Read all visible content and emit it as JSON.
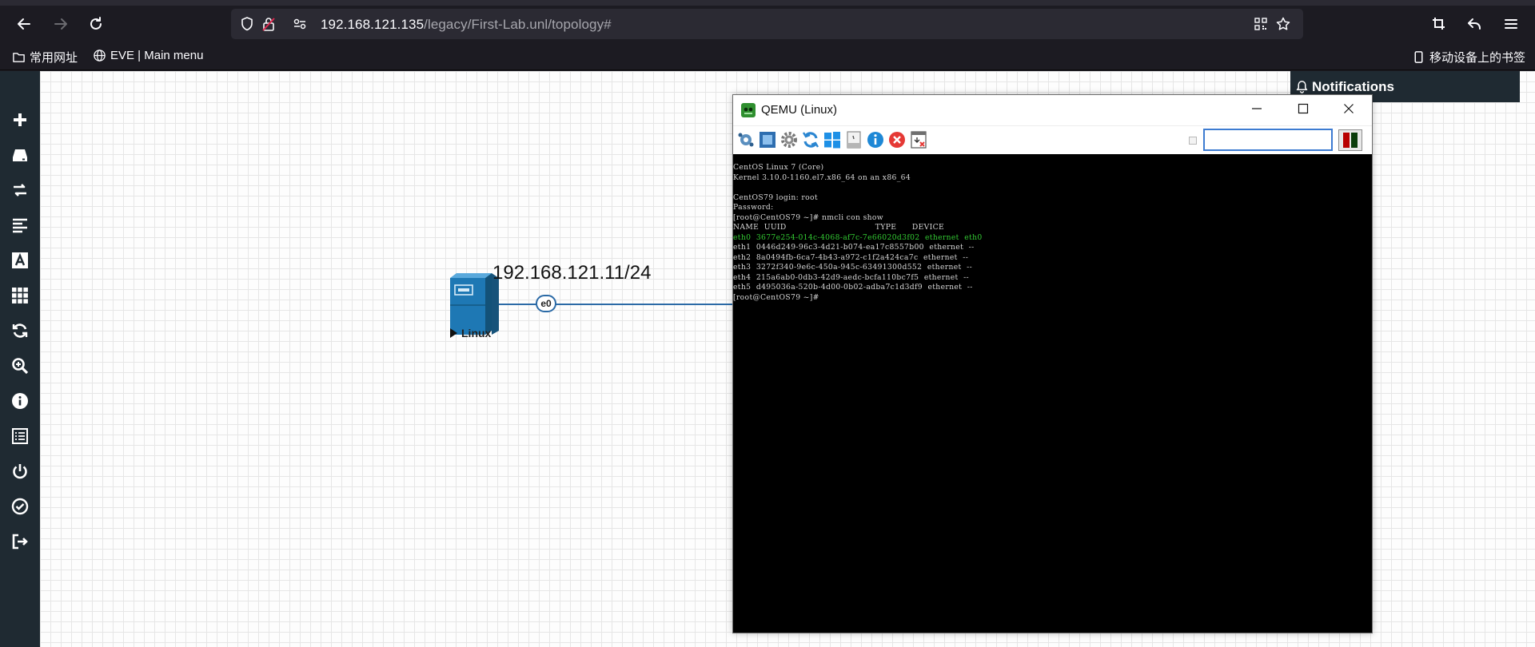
{
  "browser": {
    "url": {
      "host": "192.168.121.135",
      "path": "/legacy/First-Lab.unl/topology#"
    },
    "bookmarks": [
      {
        "label": "常用网址"
      },
      {
        "label": "EVE | Main menu"
      }
    ],
    "mobile_bookmarks": "移动设备上的书签"
  },
  "sidebar": {
    "items": [
      {
        "name": "add-object",
        "icon": "plus-icon"
      },
      {
        "name": "nodes",
        "icon": "hdd-icon"
      },
      {
        "name": "networks",
        "icon": "exchange-icon"
      },
      {
        "name": "startup-configs",
        "icon": "align-left-icon"
      },
      {
        "name": "text",
        "icon": "font-icon"
      },
      {
        "name": "status",
        "icon": "grid-icon"
      },
      {
        "name": "refresh",
        "icon": "refresh-icon"
      },
      {
        "name": "zoom",
        "icon": "zoom-icon"
      },
      {
        "name": "lab-details",
        "icon": "info-icon"
      },
      {
        "name": "workbook",
        "icon": "list-icon"
      },
      {
        "name": "shutdown",
        "icon": "power-icon"
      },
      {
        "name": "lock-lab",
        "icon": "check-circle-icon"
      },
      {
        "name": "close-lab",
        "icon": "sign-out-icon"
      }
    ]
  },
  "topology": {
    "node_label": "Linux",
    "ip_label": "192.168.121.11/24",
    "interface_label": "e0"
  },
  "notifications": {
    "title": "Notifications"
  },
  "qemu": {
    "title": "QEMU (Linux)",
    "input_value": "",
    "terminal": [
      {
        "text": "CentOS Linux 7 (Core)",
        "color": "normal"
      },
      {
        "text": "Kernel 3.10.0-1160.el7.x86_64 on an x86_64",
        "color": "normal"
      },
      {
        "text": "",
        "color": "normal"
      },
      {
        "text": "CentOS79 login: root",
        "color": "normal"
      },
      {
        "text": "Password:",
        "color": "normal"
      },
      {
        "text": "[root@CentOS79 ~]# nmcli con show",
        "color": "normal"
      },
      {
        "text": "NAME  UUID                                  TYPE      DEVICE",
        "color": "normal"
      },
      {
        "text": "eth0  3677e254-014c-4068-af7c-7e66020d3f02  ethernet  eth0",
        "color": "green"
      },
      {
        "text": "eth1  0446d249-96c3-4d21-b074-ea17c8557b00  ethernet  --",
        "color": "normal"
      },
      {
        "text": "eth2  8a0494fb-6ca7-4b43-a972-c1f2a424ca7c  ethernet  --",
        "color": "normal"
      },
      {
        "text": "eth3  3272f340-9e6c-450a-945c-63491300d552  ethernet  --",
        "color": "normal"
      },
      {
        "text": "eth4  215a6ab0-0db3-42d9-aedc-bcfa110bc7f5  ethernet  --",
        "color": "normal"
      },
      {
        "text": "eth5  d495036a-520b-4d00-0b02-adba7c1d3df9  ethernet  --",
        "color": "normal"
      },
      {
        "text": "[root@CentOS79 ~]#",
        "color": "normal"
      }
    ]
  },
  "colors": {
    "sidebar_bg": "#1f2a32",
    "link": "#2b6aa6",
    "terminal_green": "#33cc33"
  }
}
